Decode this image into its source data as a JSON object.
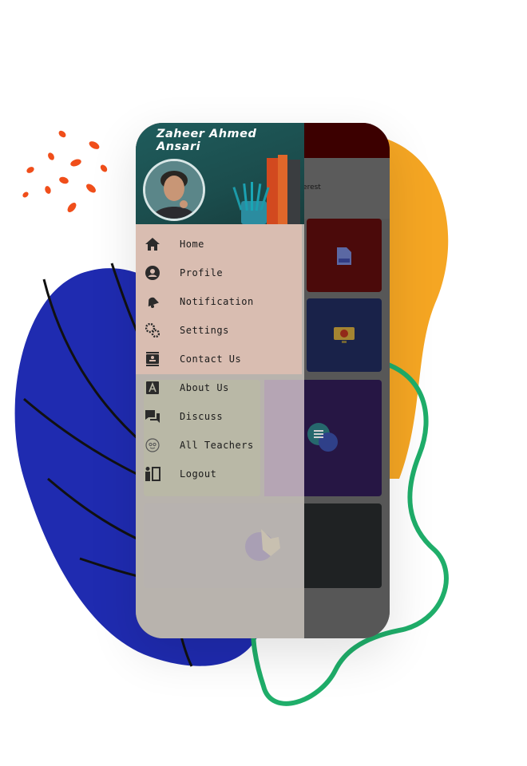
{
  "drawer": {
    "user_name": "Zaheer Ahmed Ansari",
    "menu": [
      {
        "label": "Home",
        "icon": "home-icon"
      },
      {
        "label": "Profile",
        "icon": "person-icon"
      },
      {
        "label": "Notification",
        "icon": "bell-icon"
      },
      {
        "label": "Settings",
        "icon": "gears-icon"
      },
      {
        "label": "Contact Us",
        "icon": "contact-card-icon"
      },
      {
        "label": "About Us",
        "icon": "letter-a-icon"
      },
      {
        "label": "Discuss",
        "icon": "chat-icon"
      },
      {
        "label": "All Teachers",
        "icon": "teacher-icon"
      },
      {
        "label": "Logout",
        "icon": "logout-icon"
      }
    ]
  },
  "app": {
    "strip_text": "iterest"
  },
  "colors": {
    "accent_orange": "#f5a623",
    "accent_blue": "#1f2bb0",
    "accent_green": "#1fae6a",
    "dots_red": "#f04e1a"
  }
}
